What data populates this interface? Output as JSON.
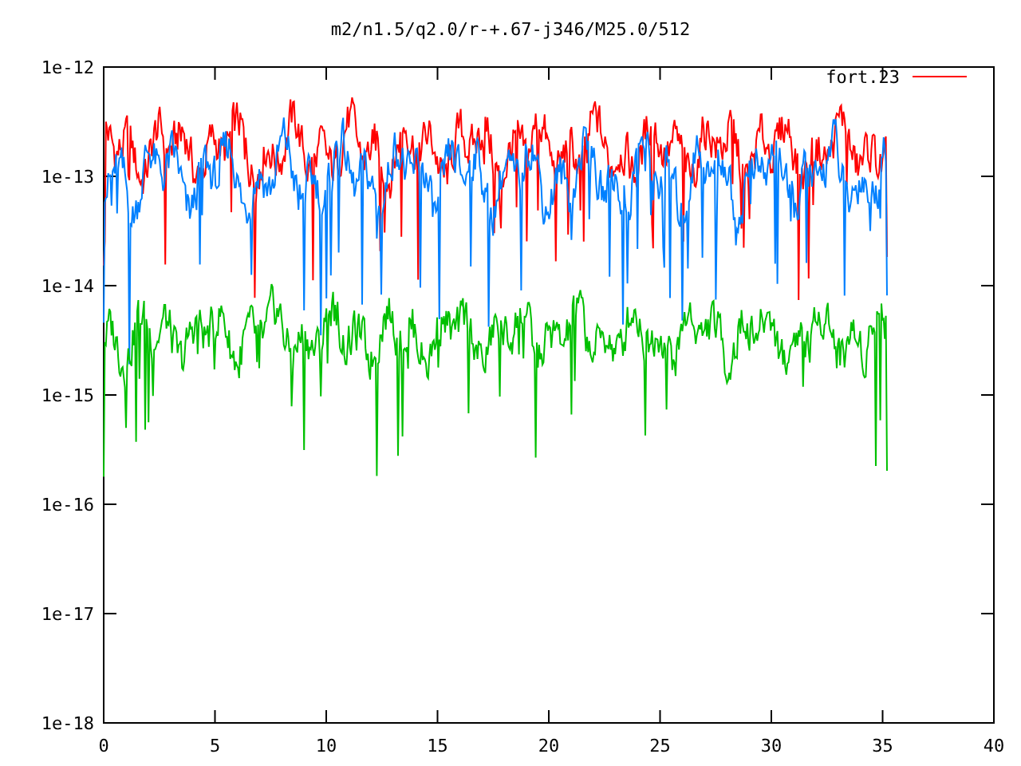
{
  "title": "m2/n1.5/q2.0/r-+.67-j346/M25.0/512",
  "legend": {
    "label": "fort.23",
    "color": "#ff0000"
  },
  "y_ticks": [
    "1e-12",
    "1e-13",
    "1e-14",
    "1e-15",
    "1e-16",
    "1e-17",
    "1e-18"
  ],
  "x_ticks": [
    "0",
    "5",
    "10",
    "15",
    "20",
    "25",
    "30",
    "35",
    "40"
  ],
  "traces": [
    {
      "color": "#ff0000"
    },
    {
      "color": "#0080ff"
    },
    {
      "color": "#00c000"
    }
  ]
}
